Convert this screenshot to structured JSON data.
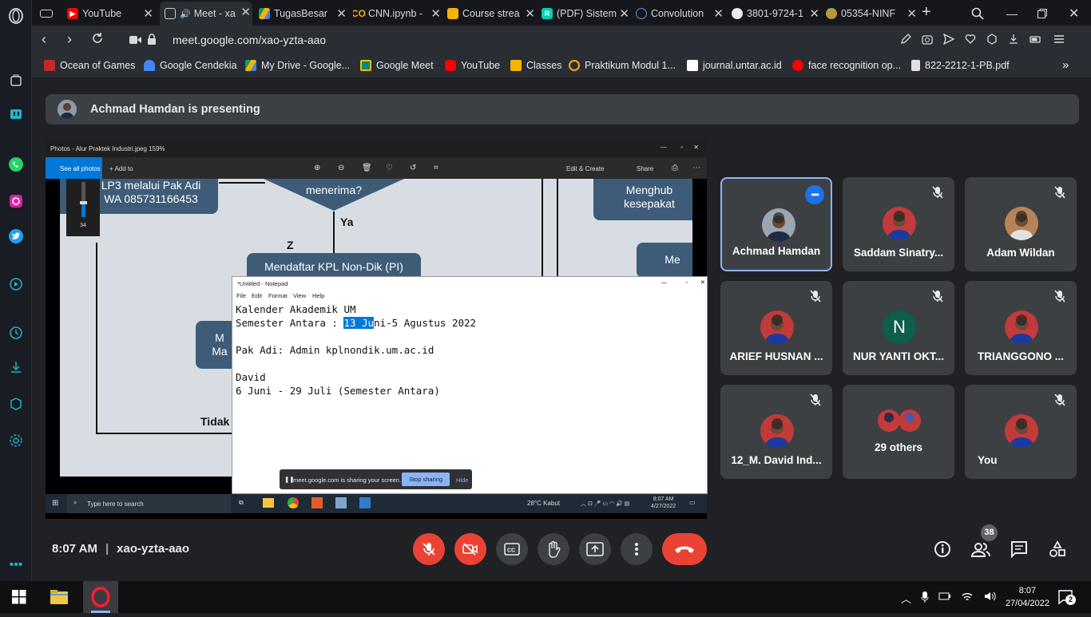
{
  "browser": {
    "tabs": [
      {
        "title": "",
        "favicon": "gamepad-icon"
      },
      {
        "title": "YouTube",
        "favicon": "youtube-icon",
        "color": "#ff0000"
      },
      {
        "title": "Meet - xa",
        "favicon": "meet-icon",
        "active": true
      },
      {
        "title": "TugasBesar",
        "favicon": "drive-icon"
      },
      {
        "title": "CNN.ipynb -",
        "favicon": "colab-icon",
        "color": "#f9ab00"
      },
      {
        "title": "Course strea",
        "favicon": "classroom-icon",
        "color": "#f4b400"
      },
      {
        "title": "(PDF) Sistem",
        "favicon": "researchgate-icon",
        "color": "#00d0af"
      },
      {
        "title": "Convolution",
        "favicon": "globe-icon"
      },
      {
        "title": "3801-9724-1",
        "favicon": "globe-icon"
      },
      {
        "title": "05354-NINF",
        "favicon": "seal-icon"
      }
    ],
    "url": "meet.google.com/xao-yzta-aao",
    "bookmarks": [
      {
        "label": "Ocean of Games",
        "color": "#c62828"
      },
      {
        "label": "Google Cendekia",
        "color": "#4285f4"
      },
      {
        "label": "My Drive - Google...",
        "color": "#0f9d58"
      },
      {
        "label": "Google Meet",
        "color": "#00897b"
      },
      {
        "label": "YouTube",
        "color": "#ff0000"
      },
      {
        "label": "Classes",
        "color": "#f4b400"
      },
      {
        "label": "Praktikum Modul 1...",
        "color": "#f9ab00"
      },
      {
        "label": "journal.untar.ac.id",
        "color": "#ffffff"
      },
      {
        "label": "face recognition op...",
        "color": "#ff0000"
      },
      {
        "label": "822-2212-1-PB.pdf",
        "color": "#e0e0e0"
      }
    ]
  },
  "meet": {
    "banner": "Achmad Hamdan is presenting",
    "time": "8:07 AM",
    "code": "xao-yzta-aao",
    "people_count": "38",
    "tiles": [
      {
        "name": "Achmad Hamdan",
        "speaking": true
      },
      {
        "name": "Saddam Sinatry...",
        "muted": true
      },
      {
        "name": "Adam Wildan",
        "muted": true
      },
      {
        "name": "ARIEF HUSNAN ...",
        "muted": true
      },
      {
        "name": "NUR YANTI OKT...",
        "muted": true,
        "initial": "N",
        "color": "#0d5e4a"
      },
      {
        "name": "TRIANGGONO ...",
        "muted": true
      },
      {
        "name": "12_M. David Ind...",
        "muted": true
      },
      {
        "name": "29 others"
      },
      {
        "name": "You",
        "muted": true
      }
    ]
  },
  "shared": {
    "photos_title": "Photos - Alur Praktek Industri.jpeg   159%",
    "see_all": "See all photos",
    "add_to": "+ Add to",
    "edit_create": "Edit & Create",
    "share": "Share",
    "flow": {
      "box1": "LP3 melalui Pak Adi\nWA 085731166453",
      "diamond": "menerima?",
      "ya": "Ya",
      "z": "Z",
      "box2": "Mendaftar KPL Non-Dik (PI)",
      "box3": "Menghub\nkesepakat",
      "box4": "Me",
      "box5": "M\nMa",
      "tidak": "Tidak",
      "slider_value": "34"
    },
    "notepad": {
      "title": "*Untitled - Notepad",
      "menu": [
        "File",
        "Edit",
        "Format",
        "View",
        "Help"
      ],
      "line1": "Kalender Akademik UM",
      "line2_pre": "Semester Antara : ",
      "line2_sel": "13 Ju",
      "line2_post": "ni-5 Agustus 2022",
      "line3": "",
      "line4": "Pak Adi: Admin kplnondik.um.ac.id",
      "line5": "",
      "line6": "David",
      "line7": "6 Juni - 29 Juli (Semester Antara)"
    },
    "sharebar": {
      "text": "meet.google.com is sharing your screen.",
      "stop": "Stop sharing",
      "hide": "Hide"
    },
    "win_taskbar": {
      "search": "Type here to search",
      "weather": "28°C  Kabut",
      "time": "8:07 AM",
      "date": "4/27/2022"
    }
  },
  "taskbar": {
    "time": "8:07",
    "date": "27/04/2022",
    "notif": "2"
  }
}
